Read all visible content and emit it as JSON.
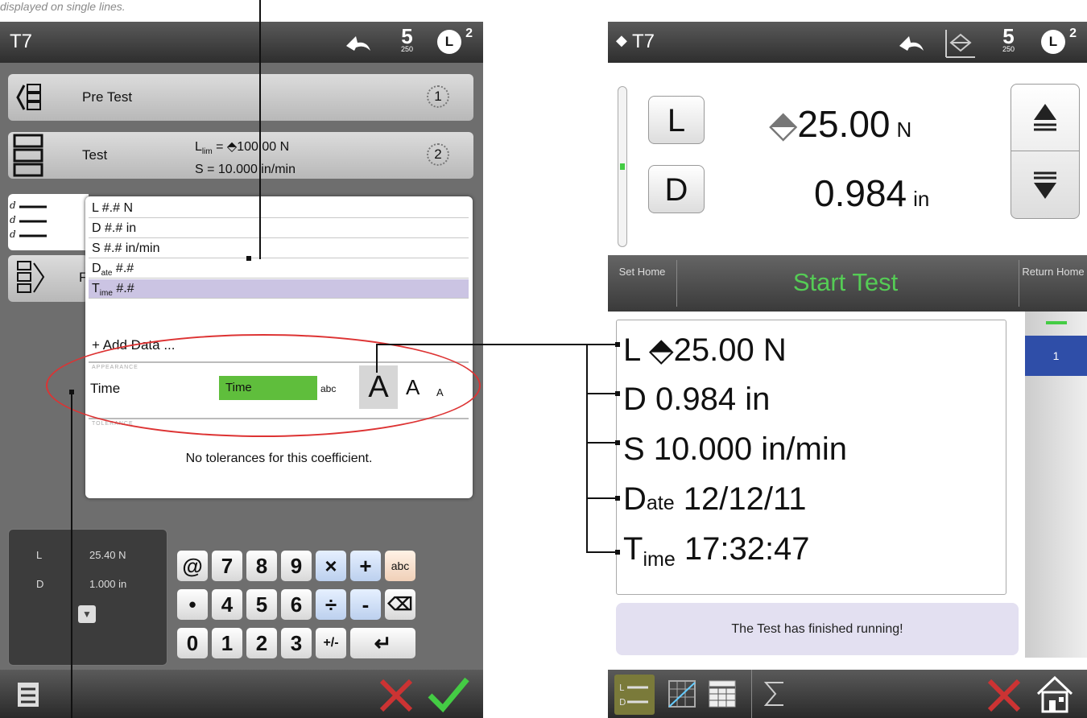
{
  "caption": "displayed on single lines.",
  "left": {
    "title": "T7",
    "speed": "5",
    "speed_sub": "250",
    "load_badge": "L",
    "load_badge_sup": "2",
    "steps": [
      {
        "label": "Pre Test",
        "num": "1"
      },
      {
        "label": "Test",
        "num": "2",
        "l_prefix": "L",
        "l_sub": "lim",
        "l_value": " = ⬘100.00 N",
        "s_value": "S = 10.000 in/min"
      }
    ],
    "step3_letter": "F",
    "data_lines": [
      "L #.# N",
      "D #.# in",
      "S #.# in/min"
    ],
    "date_line": {
      "main": "D",
      "sub": "ate",
      "rest": " #.#"
    },
    "time_line": {
      "main": "T",
      "sub": "ime",
      "rest": " #.#"
    },
    "add_data": "+ Add Data ...",
    "appearance_label": "APPEARANCE",
    "field_name": "Time",
    "field_value": "Time",
    "abc": "abc",
    "size_a": "A",
    "tolerance_label": "TOLERANCE",
    "no_tolerance": "No tolerances for this coefficient.",
    "readout": {
      "l_label": "L",
      "l_value": "25.40 N",
      "d_label": "D",
      "d_value": "1.000 in"
    },
    "keys_row1": [
      "@",
      "7",
      "8",
      "9",
      "×",
      "+",
      "abc"
    ],
    "keys_row2": [
      "•",
      "4",
      "5",
      "6",
      "÷",
      "-",
      "⌫"
    ],
    "keys_row3": [
      "0",
      "1",
      "2",
      "3",
      "+/-",
      "↵"
    ]
  },
  "right": {
    "title": "T7",
    "speed": "5",
    "speed_sub": "250",
    "load_badge": "L",
    "load_badge_sup": "2",
    "btn_l": "L",
    "btn_d": "D",
    "load_value": "25.00",
    "load_unit": "N",
    "disp_value": "0.984",
    "disp_unit": "in",
    "set_home": "Set Home",
    "start_test": "Start Test",
    "return_home": "Return Home",
    "lines": [
      {
        "main": "L ⬘25.00 N"
      },
      {
        "main": "D 0.984 in"
      },
      {
        "main": "S 10.000 in/min"
      }
    ],
    "date_line": {
      "main": "D",
      "sub": "ate",
      "rest": " 12/12/11"
    },
    "time_line": {
      "main": "T",
      "sub": "ime",
      "rest": " 17:32:47"
    },
    "page": "1",
    "message": "The Test has finished running!"
  }
}
